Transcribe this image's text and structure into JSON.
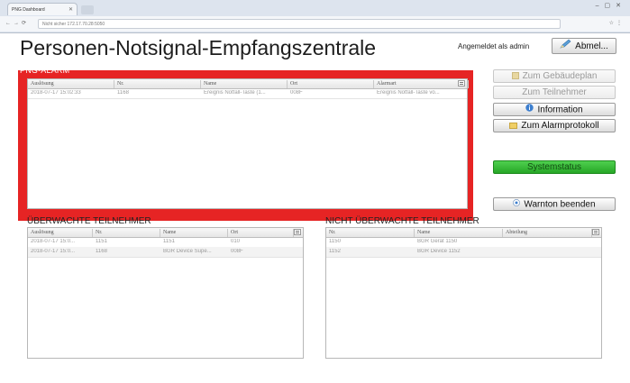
{
  "browser": {
    "tab_title": "PNG Dashboard",
    "address": "Nicht sicher  172.17.70.28:5050"
  },
  "header": {
    "title": "Personen-Notsignal-Empfangszentrale",
    "login_text": "Angemeldet als admin",
    "logout_label": "Abmel..."
  },
  "alarm": {
    "label": "PNG-ALARM",
    "columns": [
      "Auslösung",
      "Nr.",
      "Name",
      "Ort",
      "Alarmart"
    ],
    "rows": [
      [
        "2018-07-17 15:02:33",
        "1168",
        "Ereignis Notfall-Taste (1...",
        "008F",
        "Ereignis Notfall-Taste vo..."
      ]
    ]
  },
  "side_buttons": {
    "building_plan": "Zum Gebäudeplan",
    "participant": "Zum Teilnehmer",
    "information": "Information",
    "alarm_log": "Zum Alarmprotokoll",
    "system_status": "Systemstatus",
    "stop_tone": "Warnton beenden"
  },
  "monitored": {
    "title": "ÜBERWACHTE TEILNEHMER",
    "columns": [
      "Auslösung",
      "Nr.",
      "Name",
      "Ort"
    ],
    "rows": [
      [
        "2018-07-17 15:0...",
        "1151",
        "1151",
        "010"
      ],
      [
        "2018-07-17 15:0...",
        "1168",
        "BGR Device Supe...",
        "008F"
      ]
    ]
  },
  "unmonitored": {
    "title": "NICHT ÜBERWACHTE TEILNEHMER",
    "columns": [
      "Nr.",
      "Name",
      "Abteilung"
    ],
    "rows": [
      [
        "1150",
        "BGR Gerät 1150",
        ""
      ],
      [
        "1152",
        "BGR Device 1152",
        ""
      ]
    ]
  },
  "colors": {
    "alarm_red": "#e62424",
    "status_green": "#2fb52f"
  }
}
